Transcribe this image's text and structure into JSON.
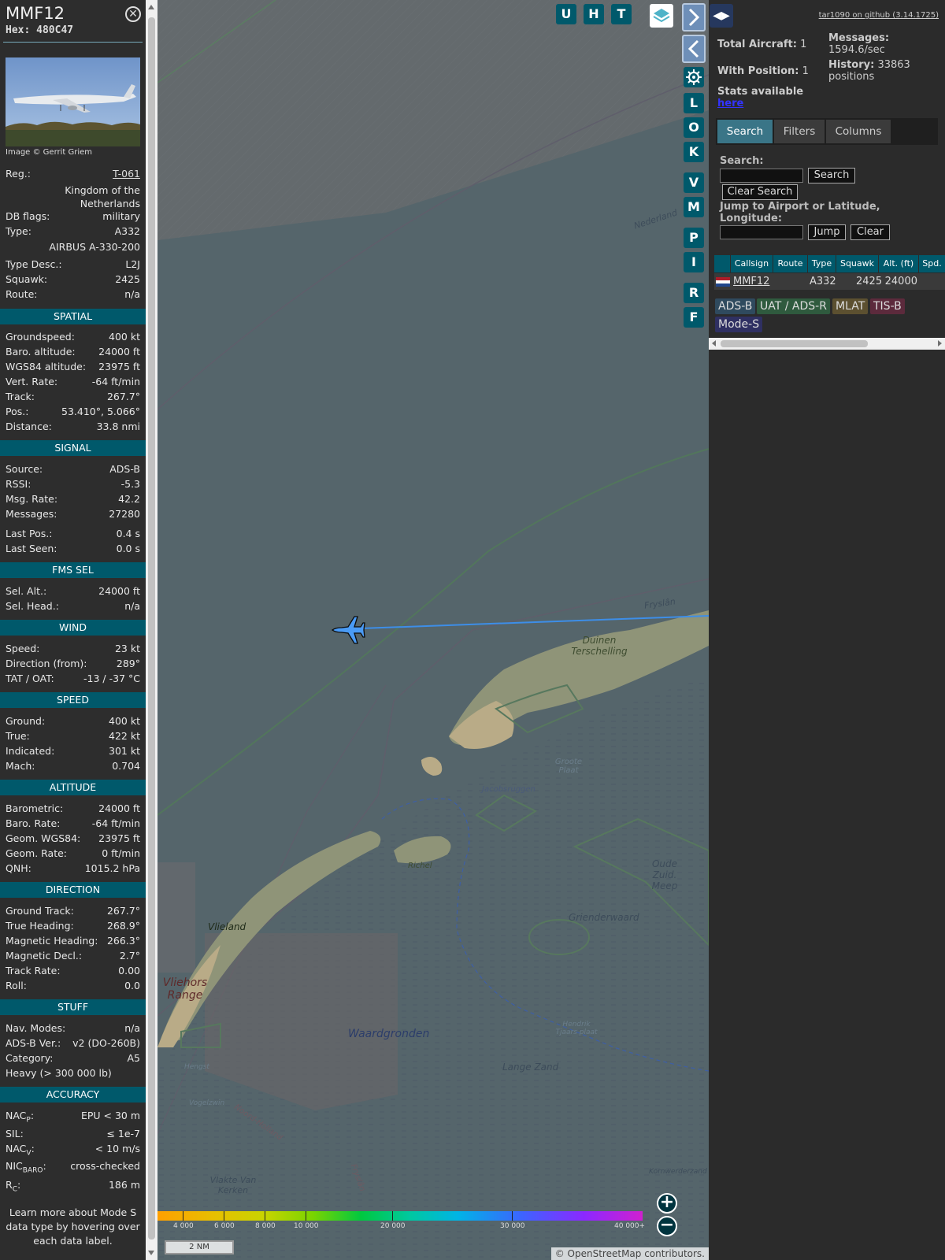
{
  "aircraft": {
    "callsign": "MMF12",
    "hex": "Hex: 480C47",
    "photo_credit": "Image © Gerrit Griem",
    "registration_label": "Reg.:",
    "registration": "T-061",
    "country": "Kingdom of the Netherlands",
    "dbflags_label": "DB flags:",
    "dbflags": "military",
    "type_label": "Type:",
    "type": "A332",
    "type_long": "AIRBUS A-330-200",
    "typedesc_label": "Type Desc.:",
    "typedesc": "L2J",
    "squawk_label": "Squawk:",
    "squawk": "2425",
    "route_label": "Route:",
    "route": "n/a"
  },
  "sections": {
    "spatial": "SPATIAL",
    "signal": "SIGNAL",
    "fms": "FMS SEL",
    "wind": "WIND",
    "speed": "SPEED",
    "altitude": "ALTITUDE",
    "direction": "DIRECTION",
    "stuff": "STUFF",
    "accuracy": "ACCURACY"
  },
  "spatial": [
    {
      "k": "Groundspeed:",
      "v": "400 kt"
    },
    {
      "k": "Baro. altitude:",
      "v": "24000 ft"
    },
    {
      "k": "WGS84 altitude:",
      "v": "23975 ft"
    },
    {
      "k": "Vert. Rate:",
      "v": "-64 ft/min"
    },
    {
      "k": "Track:",
      "v": "267.7°"
    },
    {
      "k": "Pos.:",
      "v": "53.410°, 5.066°"
    },
    {
      "k": "Distance:",
      "v": "33.8 nmi"
    }
  ],
  "signal": [
    {
      "k": "Source:",
      "v": "ADS-B"
    },
    {
      "k": "RSSI:",
      "v": "-5.3"
    },
    {
      "k": "Msg. Rate:",
      "v": "42.2"
    },
    {
      "k": "Messages:",
      "v": "27280"
    },
    {
      "k": "Last Pos.:",
      "v": "0.4 s"
    },
    {
      "k": "Last Seen:",
      "v": "0.0 s"
    }
  ],
  "fms": [
    {
      "k": "Sel. Alt.:",
      "v": "24000 ft"
    },
    {
      "k": "Sel. Head.:",
      "v": "n/a"
    }
  ],
  "wind": [
    {
      "k": "Speed:",
      "v": "23 kt"
    },
    {
      "k": "Direction (from):",
      "v": "289°"
    },
    {
      "k": "TAT / OAT:",
      "v": "-13 / -37 °C"
    }
  ],
  "speed": [
    {
      "k": "Ground:",
      "v": "400 kt"
    },
    {
      "k": "True:",
      "v": "422 kt"
    },
    {
      "k": "Indicated:",
      "v": "301 kt"
    },
    {
      "k": "Mach:",
      "v": "0.704"
    }
  ],
  "altitude": [
    {
      "k": "Barometric:",
      "v": "24000 ft"
    },
    {
      "k": "Baro. Rate:",
      "v": "-64 ft/min"
    },
    {
      "k": "Geom. WGS84:",
      "v": "23975 ft"
    },
    {
      "k": "Geom. Rate:",
      "v": "0 ft/min"
    },
    {
      "k": "QNH:",
      "v": "1015.2 hPa"
    }
  ],
  "direction": [
    {
      "k": "Ground Track:",
      "v": "267.7°"
    },
    {
      "k": "True Heading:",
      "v": "268.9°"
    },
    {
      "k": "Magnetic Heading:",
      "v": "266.3°"
    },
    {
      "k": "Magnetic Decl.:",
      "v": "2.7°"
    },
    {
      "k": "Track Rate:",
      "v": "0.00"
    },
    {
      "k": "Roll:",
      "v": "0.0"
    }
  ],
  "stuff": [
    {
      "k": "Nav. Modes:",
      "v": "n/a"
    },
    {
      "k": "ADS-B Ver.:",
      "v": "v2 (DO-260B)"
    },
    {
      "k": "Category:",
      "v": "A5"
    }
  ],
  "stuff_extra": "Heavy (> 300 000 lb)",
  "accuracy": [
    {
      "k": "NAC",
      "sub": "P",
      "k2": ":",
      "v": "EPU < 30 m"
    },
    {
      "k": "SIL:",
      "sub": "",
      "k2": "",
      "v": "≤ 1e-7"
    },
    {
      "k": "NAC",
      "sub": "V",
      "k2": ":",
      "v": "< 10 m/s"
    },
    {
      "k": "NIC",
      "sub": "BARO",
      "k2": ":",
      "v": "cross-checked"
    },
    {
      "k": "R",
      "sub": "C",
      "k2": ":",
      "v": "186 m"
    }
  ],
  "learn_more": "Learn more about Mode S data type by hovering over each data label.",
  "map": {
    "labels": [
      "Nederland",
      "Fryslân",
      "Duinen Terschelling",
      "Groote Plaat",
      "Jacobsruggen",
      "Richel",
      "Oude Zuid. Meep",
      "Grienderwaard",
      "Vlieland",
      "Vliehors Range",
      "Waardgronden",
      "Hendrik Tjaars plaat",
      "Lange Zand",
      "Hengst",
      "Vogelzwin",
      "Noord-Holland",
      "Fryslân",
      "Vlakte Van Kerken",
      "Kornwerderzand"
    ],
    "buttons": [
      "U",
      "H",
      "T"
    ],
    "side_buttons": [
      "L",
      "O",
      "K",
      "V",
      "M",
      "P",
      "I",
      "R",
      "F"
    ],
    "altitude_scale": [
      "4 000",
      "6 000",
      "8 000",
      "10 000",
      "20 000",
      "30 000",
      "40 000+"
    ],
    "scale_bar": "2 NM",
    "attribution": "© OpenStreetMap contributors.",
    "zoom_in": "+",
    "zoom_out": "−"
  },
  "right": {
    "toggle": "◀▶",
    "github": "tar1090 on github (3.14.1725)",
    "total_aircraft_label": "Total Aircraft:",
    "total_aircraft": "1",
    "with_position_label": "With Position:",
    "with_position": "1",
    "messages_label": "Messages:",
    "messages": "1594.6/sec",
    "history_label": "History:",
    "history_value": "33863",
    "history_unit": "positions",
    "stats_label": "Stats available",
    "stats_link": "here",
    "tabs": [
      "Search",
      "Filters",
      "Columns"
    ],
    "search_label": "Search:",
    "search_button": "Search",
    "clear_search_button": "Clear Search",
    "jump_label": "Jump to Airport or Latitude, Longitude:",
    "jump_button": "Jump",
    "clear_button": "Clear",
    "columns": [
      "Callsign",
      "Route",
      "Type",
      "Squawk",
      "Alt. (ft)",
      "Spd."
    ],
    "row": {
      "callsign": "MMF12",
      "route": "",
      "type": "A332",
      "squawk": "2425",
      "alt": "24000"
    },
    "badges": [
      "ADS-B",
      "UAT / ADS-R",
      "MLAT",
      "TIS-B",
      "Mode-S"
    ]
  },
  "colors": {
    "section_bg": "#00596b",
    "map_water": "#55656b",
    "track_line": "#3d8ee8",
    "aircraft": "#4a9bf5"
  }
}
